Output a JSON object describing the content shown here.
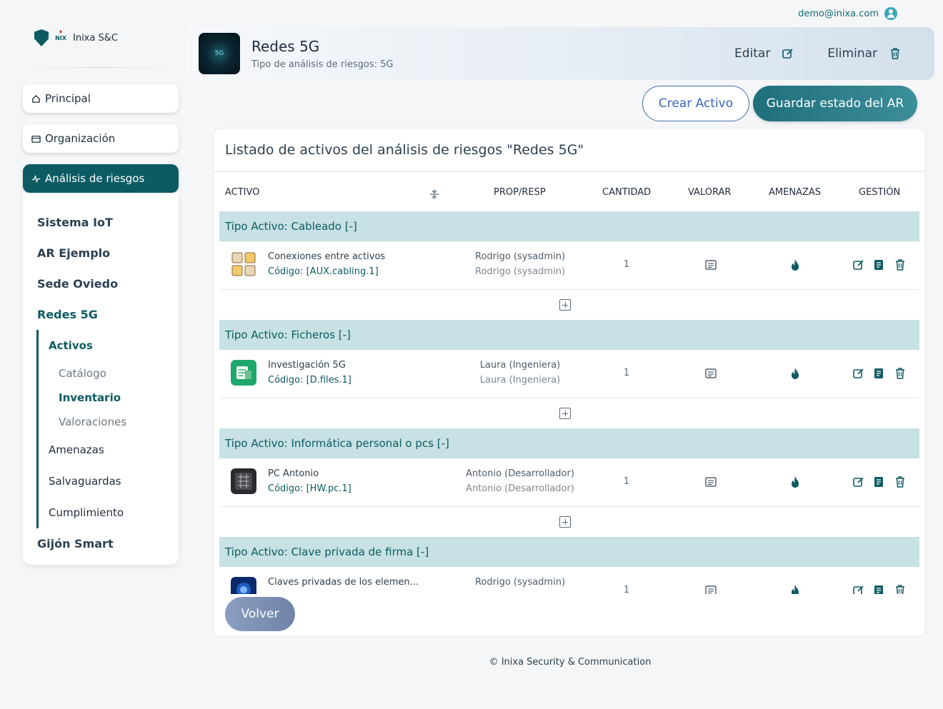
{
  "user": {
    "email": "demo@inixa.com"
  },
  "brand": {
    "name": "Inixa S&C",
    "mini": "NIX"
  },
  "sidebar": {
    "principal": "Principal",
    "organizacion": "Organización",
    "analisis": "Análisis de riesgos",
    "items": [
      "Sistema IoT",
      "AR Ejemplo",
      "Sede Oviedo",
      "Redes 5G"
    ],
    "activos": "Activos",
    "catalogo": "Catálogo",
    "inventario": "Inventario",
    "valoraciones": "Valoraciones",
    "amenazas": "Amenazas",
    "salvaguardas": "Salvaguardas",
    "cumplimiento": "Cumplimiento",
    "gijon": "Gijón Smart"
  },
  "header": {
    "thumb_text": "5G",
    "title": "Redes 5G",
    "subtitle": "Tipo de análisis de riesgos: 5G",
    "edit": "Editar",
    "delete": "Eliminar"
  },
  "actions": {
    "create": "Crear Activo",
    "save": "Guardar estado del AR",
    "back": "Volver"
  },
  "card": {
    "title": "Listado de activos del análisis de riesgos \"Redes 5G\"",
    "columns": {
      "activo": "ACTIVO",
      "prop": "PROP/RESP",
      "cantidad": "CANTIDAD",
      "valorar": "VALORAR",
      "amenazas": "AMENAZAS",
      "gestion": "GESTIÓN"
    }
  },
  "groups": [
    {
      "title": "Tipo Activo: Cableado [-]",
      "asset": {
        "name": "Conexiones entre activos",
        "code": "Código: [AUX.cabling.1]",
        "prop": "Rodrigo (sysadmin)",
        "resp": "Rodrigo (sysadmin)",
        "qty": "1"
      }
    },
    {
      "title": "Tipo Activo: Ficheros [-]",
      "asset": {
        "name": "Investigación 5G",
        "code": "Código: [D.files.1]",
        "prop": "Laura (Ingeniera)",
        "resp": "Laura (Ingeniera)",
        "qty": "1"
      }
    },
    {
      "title": "Tipo Activo: Informática personal o pcs [-]",
      "asset": {
        "name": "PC Antonio",
        "code": "Código: [HW.pc.1]",
        "prop": "Antonio (Desarrollador)",
        "resp": "Antonio (Desarrollador)",
        "qty": "1"
      }
    },
    {
      "title": "Tipo Activo: Clave privada de firma [-]",
      "asset": {
        "name": "Claves privadas de los elemen...",
        "prop": "Rodrigo (sysadmin)",
        "qty": "1"
      }
    }
  ],
  "footer": {
    "copyright": "©",
    "company": "Inixa Security & Communication"
  },
  "colors": {
    "primary": "#0c5b63",
    "group_bg": "#c7e1e4",
    "accent_blue": "#3a66b8"
  }
}
